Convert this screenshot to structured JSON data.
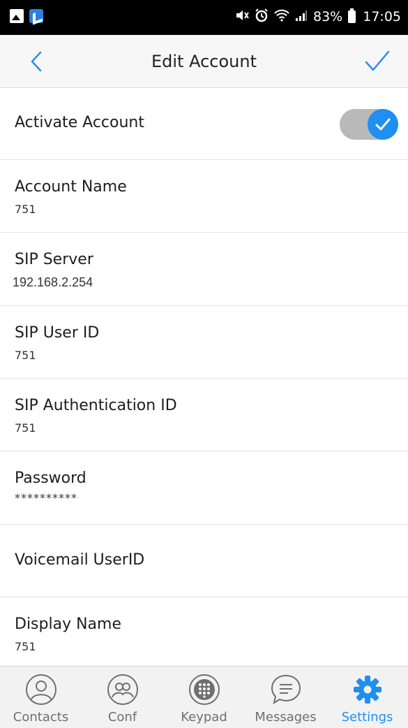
{
  "status_bar": {
    "battery": "83%",
    "time": "17:05"
  },
  "header": {
    "title": "Edit Account"
  },
  "rows": [
    {
      "label": "Activate Account",
      "toggle_on": true
    },
    {
      "label": "Account Name",
      "value": "751"
    },
    {
      "label": "SIP Server",
      "value": "192.168.2.254"
    },
    {
      "label": "SIP User ID",
      "value": "751"
    },
    {
      "label": "SIP Authentication ID",
      "value": "751"
    },
    {
      "label": "Password",
      "value": "**********"
    },
    {
      "label": "Voicemail UserID",
      "value": ""
    },
    {
      "label": "Display Name",
      "value": "751"
    }
  ],
  "tabs": [
    {
      "label": "Contacts",
      "icon": "contacts-icon",
      "active": false
    },
    {
      "label": "Conf",
      "icon": "conference-icon",
      "active": false
    },
    {
      "label": "Keypad",
      "icon": "keypad-icon",
      "active": false
    },
    {
      "label": "Messages",
      "icon": "messages-icon",
      "active": false
    },
    {
      "label": "Settings",
      "icon": "gear-icon",
      "active": true
    }
  ],
  "colors": {
    "accent": "#1f8ff0",
    "tab_inactive": "#6f6f6f",
    "header_bg": "#f7f7f7"
  }
}
